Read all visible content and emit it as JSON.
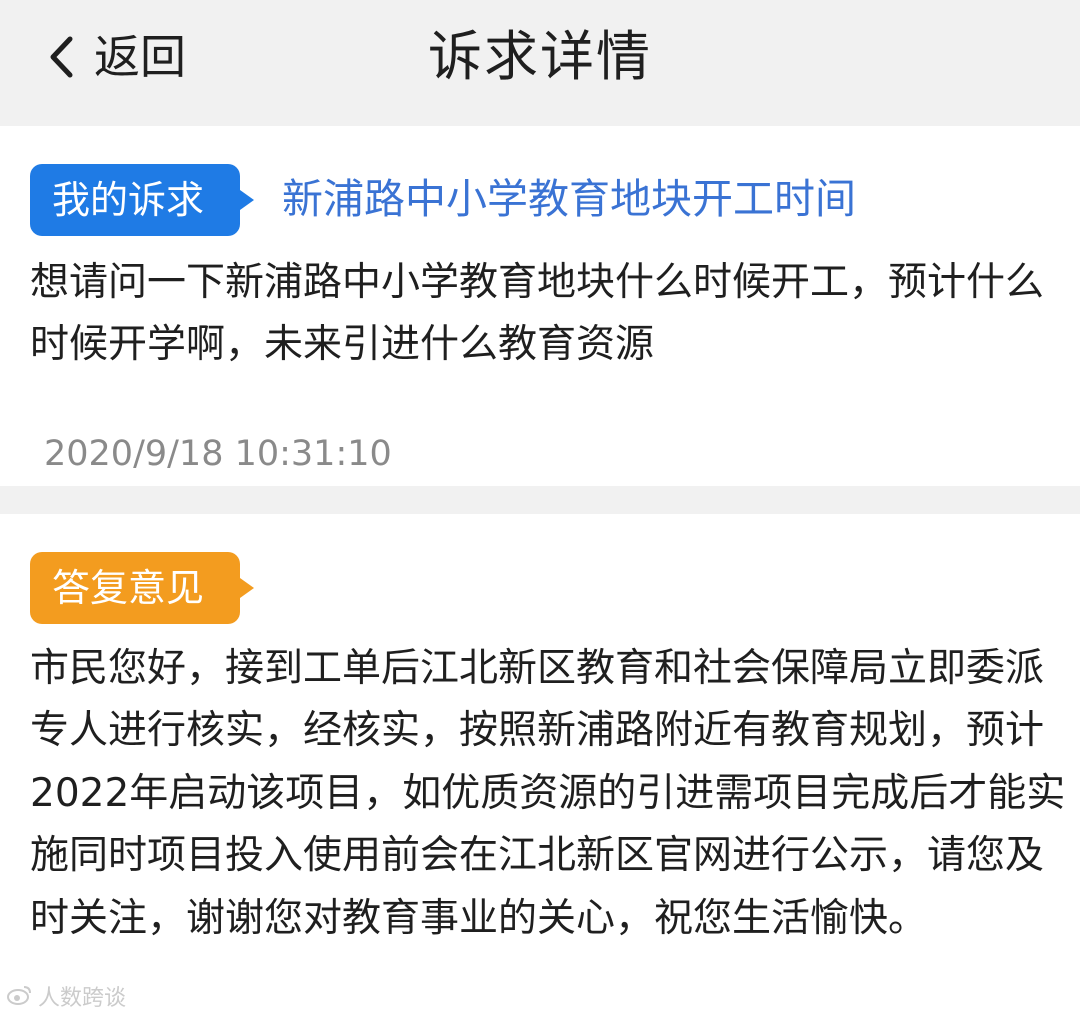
{
  "header": {
    "back_label": "返回",
    "title": "诉求详情"
  },
  "appeal": {
    "tag": "我的诉求",
    "subject": "新浦路中小学教育地块开工时间",
    "body": "想请问一下新浦路中小学教育地块什么时候开工，预计什么时候开学啊，未来引进什么教育资源",
    "timestamp": "2020/9/18 10:31:10"
  },
  "reply": {
    "tag": "答复意见",
    "body": "市民您好，接到工单后江北新区教育和社会保障局立即委派专人进行核实，经核实，按照新浦路附近有教育规划，预计2022年启动该项目，如优质资源的引进需项目完成后才能实施同时项目投入使用前会在江北新区官网进行公示，请您及时关注，谢谢您对教育事业的关心，祝您生活愉快。"
  },
  "watermark": {
    "text": "人数跨谈"
  },
  "colors": {
    "header_bg": "#f1f1f1",
    "appeal_tag": "#1f7be5",
    "reply_tag": "#f39c1f",
    "subject_text": "#3a73d4",
    "timestamp_text": "#8a8a8a"
  },
  "icons": {
    "back": "chevron-left-icon",
    "watermark": "weibo-logo-icon"
  }
}
